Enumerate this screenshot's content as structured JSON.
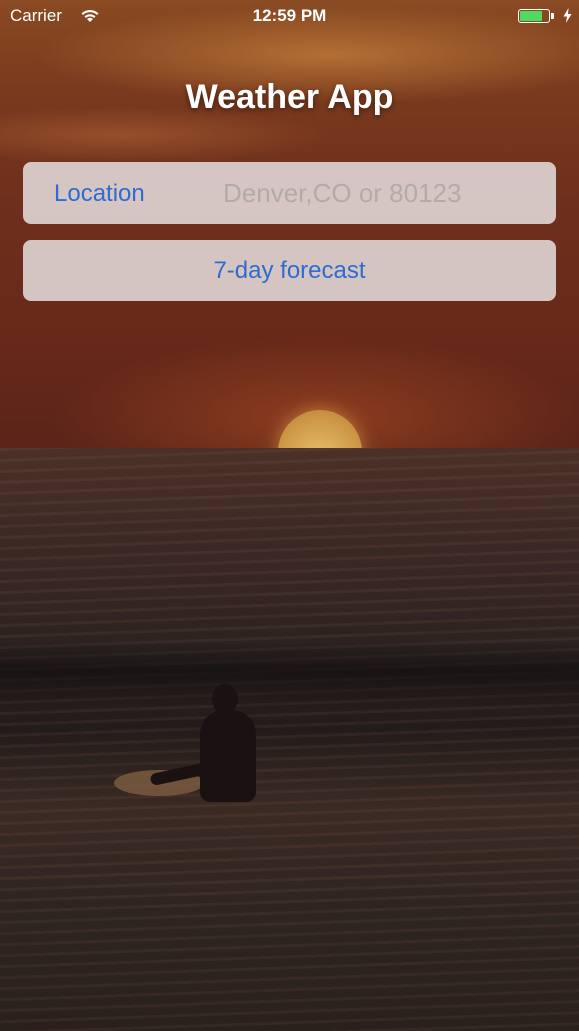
{
  "status_bar": {
    "carrier": "Carrier",
    "time": "12:59 PM",
    "wifi_icon": "wifi-icon",
    "battery_icon": "battery-icon",
    "charging_icon": "bolt-icon",
    "battery_color": "#4cd964"
  },
  "app": {
    "title": "Weather App"
  },
  "location": {
    "label": "Location",
    "placeholder": "Denver,CO or 80123",
    "value": ""
  },
  "forecast_button": {
    "label": "7-day forecast"
  },
  "colors": {
    "accent": "#2f6bd0",
    "field_background": "#ebe6e8",
    "title_text": "#ffffff"
  }
}
